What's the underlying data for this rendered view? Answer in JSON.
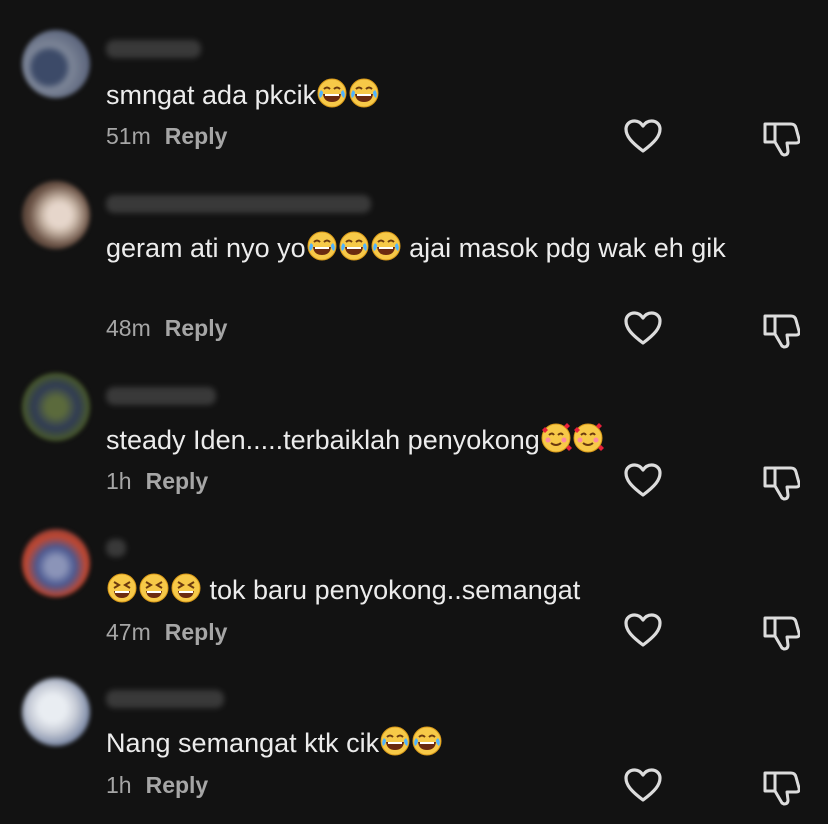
{
  "comments": [
    {
      "text_parts": [
        "smngat ada pkcik"
      ],
      "emoji_after": [
        "laugh-cry",
        "laugh-cry"
      ],
      "time": "51m",
      "reply_label": "Reply"
    },
    {
      "text_parts": [
        "geram ati nyo yo",
        " ajai masok pdg wak eh gik"
      ],
      "time": "48m",
      "reply_label": "Reply"
    },
    {
      "text_parts": [
        "steady Iden.....terbaiklah penyokong"
      ],
      "time": "1h",
      "reply_label": "Reply"
    },
    {
      "text_parts": [
        "tok baru penyokong..semangat"
      ],
      "time": "47m",
      "reply_label": "Reply"
    },
    {
      "text_parts": [
        "Nang semangat ktk cik"
      ],
      "time": "1h",
      "reply_label": "Reply"
    }
  ],
  "icons": {
    "like": "heart-outline-icon",
    "dislike": "thumbs-down-outline-icon"
  },
  "colors": {
    "background": "#121212",
    "text": "#ececec",
    "meta": "#a6a6a6"
  }
}
